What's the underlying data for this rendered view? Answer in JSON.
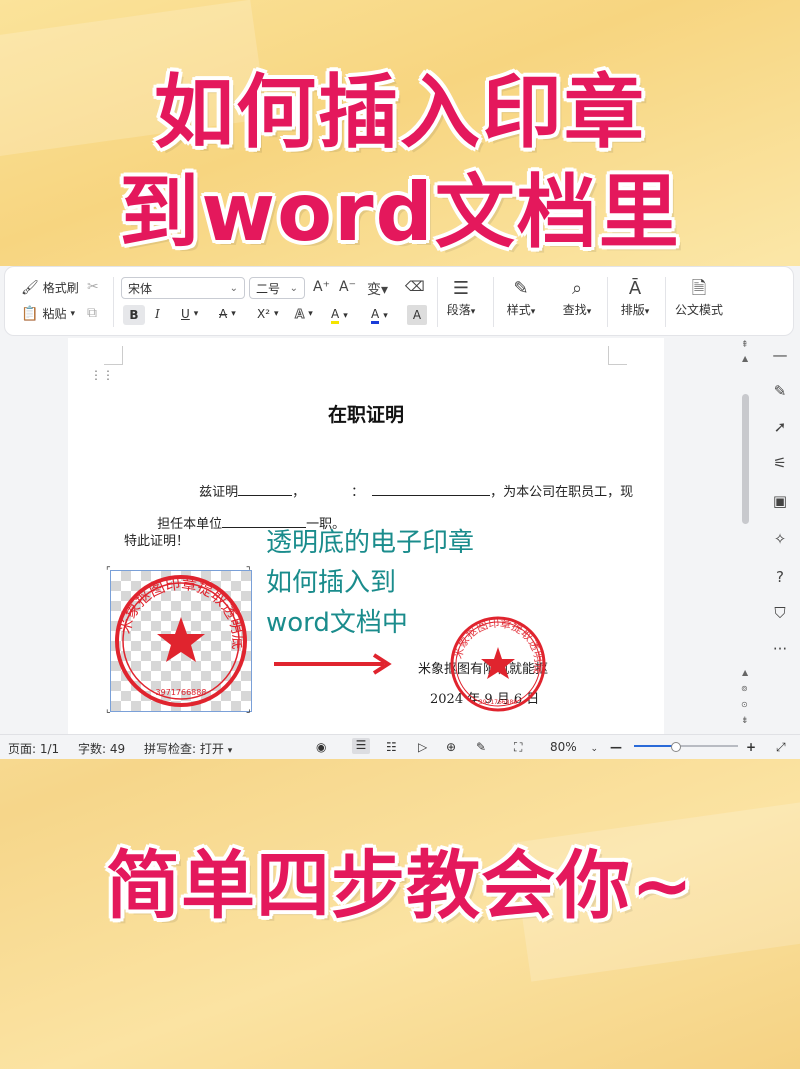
{
  "headline": {
    "line1": "如何插入印章",
    "line2": "到word文档里",
    "line3": "简单四步教会你~"
  },
  "toolbar": {
    "format_painter": "格式刷",
    "paste": "粘贴",
    "font_name": "宋体",
    "font_size": "二号",
    "paragraph": "段落",
    "styles": "样式",
    "find": "查找",
    "layout": "排版",
    "official_mode": "公文模式",
    "bold": "B",
    "italic": "I",
    "underline": "U",
    "strike": "A",
    "superscript": "X²",
    "text_effect": "A",
    "highlight": "A",
    "font_color": "A",
    "char_shade": "A"
  },
  "document": {
    "title": "在职证明",
    "line1_a": "兹证明",
    "line1_b": "，",
    "line1_c": "：",
    "line1_d": "，为本公司在职员工，现",
    "line2_a": "担任本单位",
    "line2_b": "一职。",
    "line3": "特此证明！",
    "overlay_text": [
      "透明底的电子印章",
      "如何插入到",
      "word文档中"
    ],
    "company": "米象抠图有限机就能抠",
    "date": "2024 年 9 月 6 日",
    "seal_text": "米象抠图印章提取透明底",
    "seal_number": "3971766888"
  },
  "statusbar": {
    "page": "页面: 1/1",
    "words": "字数: 49",
    "spell": "拼写检查: 打开",
    "zoom": "80%"
  },
  "colors": {
    "headline": "#e4185c",
    "seal": "#e0242e",
    "teal": "#1a8c8c",
    "arrow": "#e0242e"
  }
}
